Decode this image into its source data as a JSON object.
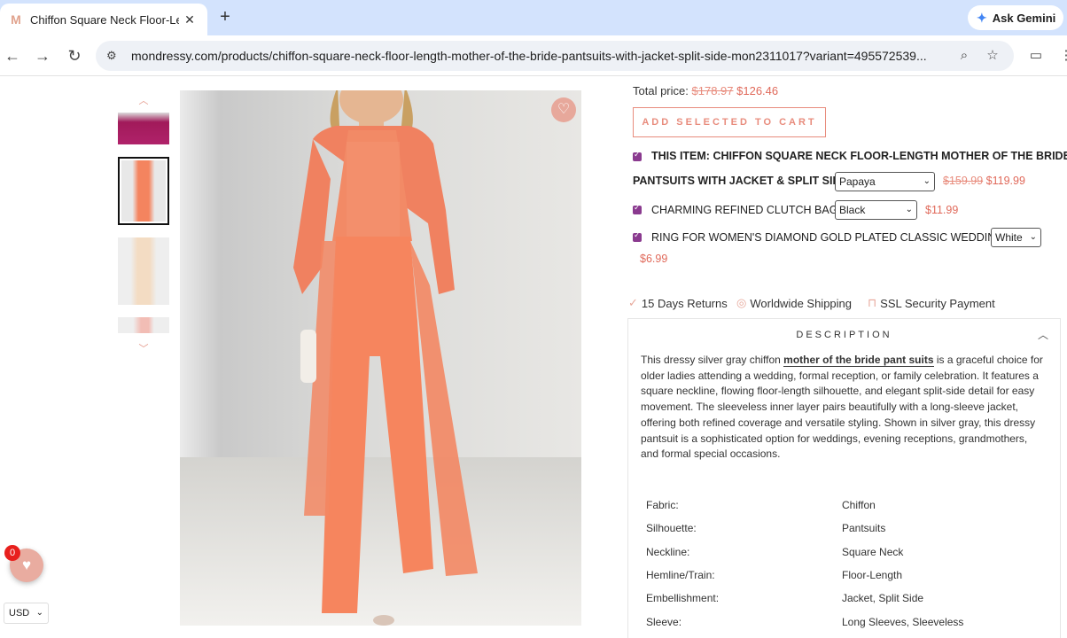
{
  "browser": {
    "tab_title": "Chiffon Square Neck Floor-Leng",
    "tab_close": "✕",
    "new_tab": "+",
    "ask_gemini": "Ask Gemini",
    "url": "mondressy.com/products/chiffon-square-neck-floor-length-mother-of-the-bride-pantsuits-with-jacket-split-side-mon2311017?variant=495572539..."
  },
  "product": {
    "total_label": "Total price:",
    "total_original": "$178.97",
    "total_sale": "$126.46",
    "add_selected": "ADD SELECTED TO CART",
    "bundle": [
      {
        "prefix": "THIS ITEM:",
        "name_line1": "CHIFFON SQUARE NECK FLOOR-LENGTH MOTHER OF THE BRIDE",
        "name_line2": "PANTSUITS WITH JACKET & SPLIT SIDE",
        "option": "Papaya",
        "original": "$159.99",
        "sale": "$119.99"
      },
      {
        "name": "CHARMING REFINED CLUTCH BAGS",
        "option": "Black",
        "sale": "$11.99"
      },
      {
        "name": "RING FOR WOMEN'S DIAMOND GOLD PLATED CLASSIC WEDDING",
        "option": "White",
        "sale": "$6.99"
      }
    ],
    "trust": [
      "15 Days Returns",
      "Worldwide Shipping",
      "SSL Security Payment"
    ],
    "description": {
      "heading": "DESCRIPTION",
      "text_before": "This dressy silver gray chiffon ",
      "link": "mother of the bride pant suits",
      "text_after": " is a graceful choice for older ladies attending a wedding, formal reception, or family celebration. It features a square neckline, flowing floor-length silhouette, and elegant split-side detail for easy movement. The sleeveless inner layer pairs beautifully with a long-sleeve jacket, offering both refined coverage and versatile styling. Shown in silver gray, this dressy pantsuit is a sophisticated option for weddings, evening receptions, grandmothers, and formal special occasions.",
      "specs": [
        {
          "key": "Fabric:",
          "value": "Chiffon"
        },
        {
          "key": "Silhouette:",
          "value": "Pantsuits"
        },
        {
          "key": "Neckline:",
          "value": "Square Neck"
        },
        {
          "key": "Hemline/Train:",
          "value": "Floor-Length"
        },
        {
          "key": "Embellishment:",
          "value": "Jacket, Split Side"
        },
        {
          "key": "Sleeve:",
          "value": "Long Sleeves, Sleeveless"
        }
      ]
    }
  },
  "wishlist_count": "0",
  "currency": "USD",
  "colors": {
    "accent": "#e88c7d",
    "sale": "#e0695a",
    "dress": "#f4845f",
    "checkbox": "#8a3a8f"
  }
}
